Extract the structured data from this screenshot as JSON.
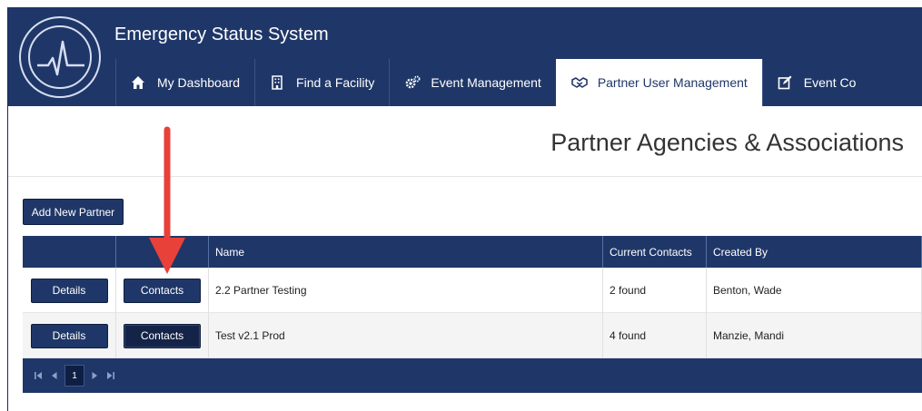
{
  "app": {
    "title": "Emergency Status System"
  },
  "nav": {
    "tabs": [
      {
        "label": "My Dashboard",
        "icon": "home-icon",
        "active": false
      },
      {
        "label": "Find a Facility",
        "icon": "building-icon",
        "active": false
      },
      {
        "label": "Event Management",
        "icon": "gears-icon",
        "active": false
      },
      {
        "label": "Partner User Management",
        "icon": "handshake-icon",
        "active": true
      },
      {
        "label": "Event Co",
        "icon": "edit-icon",
        "active": false
      }
    ]
  },
  "page": {
    "title": "Partner Agencies & Associations",
    "add_button": "Add New Partner"
  },
  "grid": {
    "columns": [
      "",
      "",
      "Name",
      "Current Contacts",
      "Created By"
    ],
    "rows": [
      {
        "details": "Details",
        "contacts": "Contacts",
        "name": "2.2 Partner Testing",
        "current_contacts": "2 found",
        "created_by": "Benton, Wade"
      },
      {
        "details": "Details",
        "contacts": "Contacts",
        "name": "Test v2.1 Prod",
        "current_contacts": "4 found",
        "created_by": "Manzie, Mandi"
      }
    ],
    "pager": {
      "current_page": "1"
    }
  },
  "colors": {
    "brand": "#1f3768",
    "annotation": "#e8413a"
  }
}
